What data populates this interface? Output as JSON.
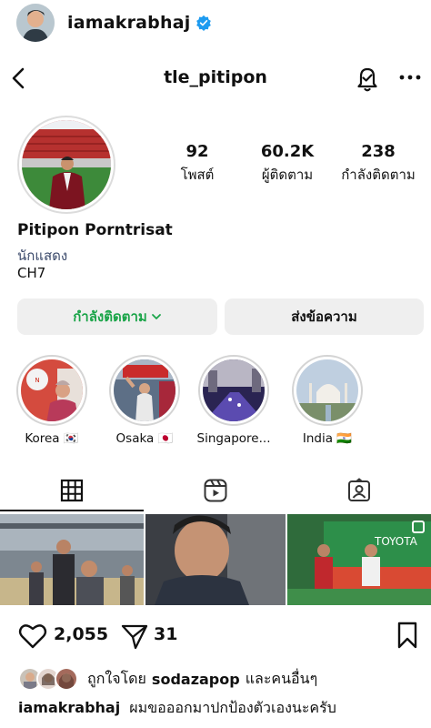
{
  "post_author": {
    "username": "iamakrabhaj",
    "verified_icon": "verified-badge-icon",
    "accent": "#1d9bf0"
  },
  "header": {
    "handle": "tle_pitipon",
    "icons": [
      "back-icon",
      "notification-bell-icon",
      "more-icon"
    ]
  },
  "profile": {
    "stats": [
      {
        "value": "92",
        "label": "โพสต์"
      },
      {
        "value": "60.2K",
        "label": "ผู้ติดตาม"
      },
      {
        "value": "238",
        "label": "กำลังติดตาม"
      }
    ],
    "full_name": "Pitipon Porntrisat",
    "category": "นักแสดง",
    "bio": "CH7"
  },
  "buttons": {
    "following": "กำลังติดตาม",
    "message": "ส่งข้อความ",
    "following_color": "#1aa448"
  },
  "highlights": [
    {
      "label": "Korea 🇰🇷"
    },
    {
      "label": "Osaka 🇯🇵"
    },
    {
      "label": "Singapore..."
    },
    {
      "label": "India 🇮🇳"
    }
  ],
  "tabs": [
    "grid-icon",
    "reels-icon",
    "tagged-icon"
  ],
  "post": {
    "likes": "2,055",
    "shares": "31",
    "liked_by_prefix": "ถูกใจโดย",
    "liked_by_user": "sodazapop",
    "liked_by_suffix": "และคนอื่นๆ",
    "caption_user": "iamakrabhaj",
    "caption_text": "ผมขอออกมาปกป้องตัวเองนะครับ"
  }
}
